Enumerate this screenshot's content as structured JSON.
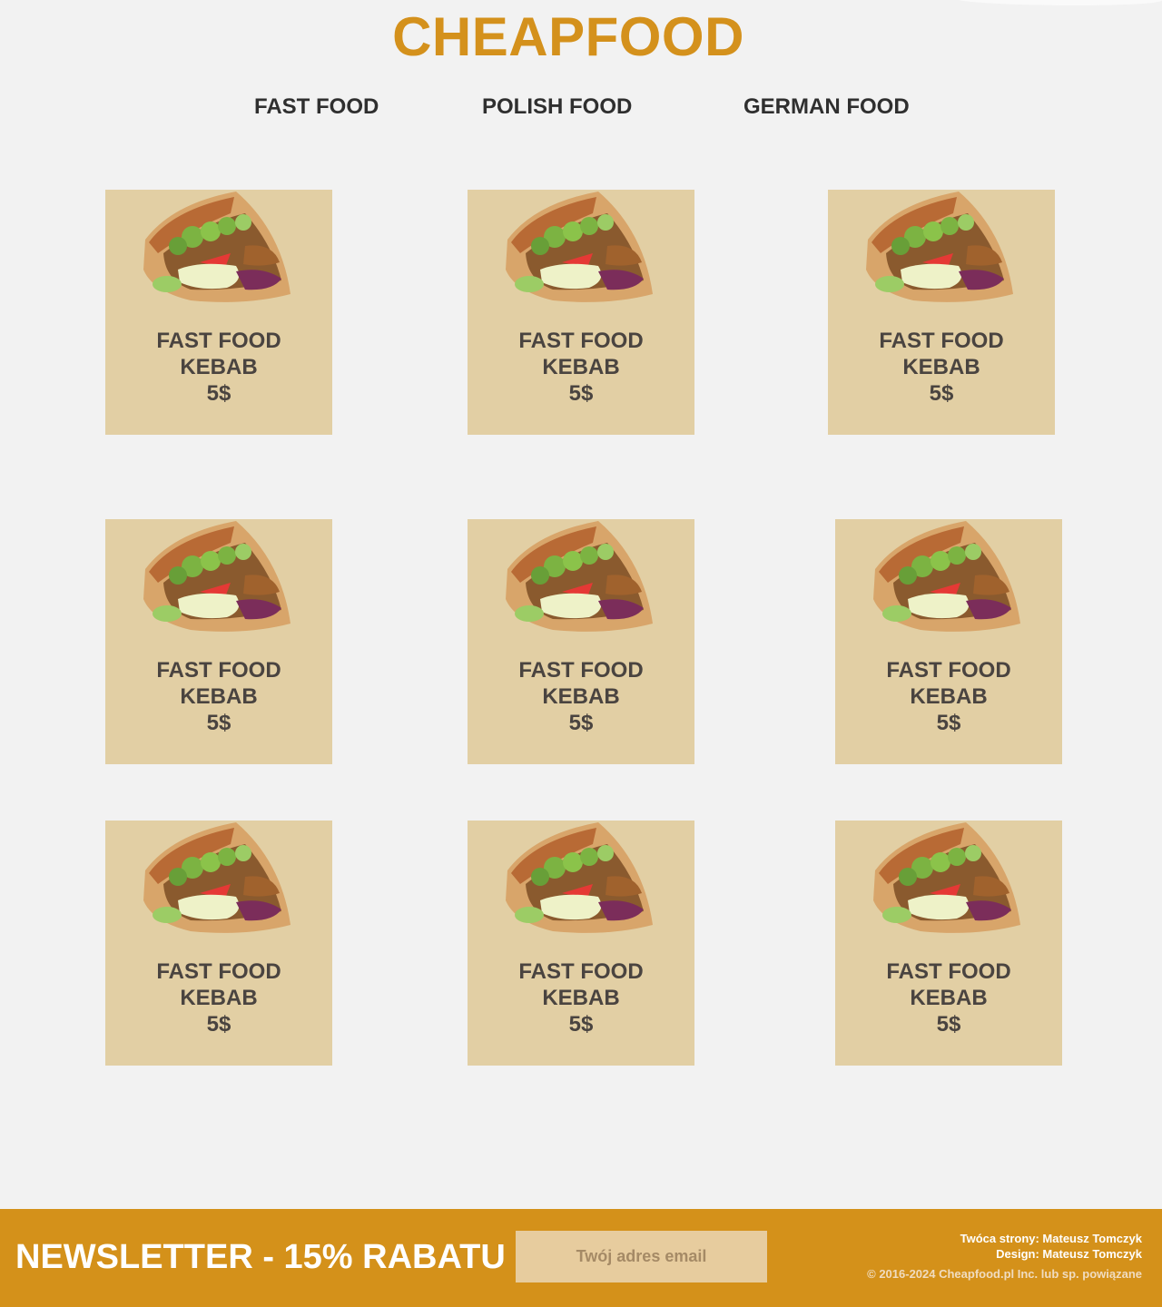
{
  "header": {
    "logo": "CHEAPFOOD"
  },
  "nav": [
    {
      "label": "FAST FOOD"
    },
    {
      "label": "POLISH FOOD"
    },
    {
      "label": "GERMAN FOOD"
    }
  ],
  "products": [
    {
      "category": "FAST FOOD",
      "name": "KEBAB",
      "price": "5$",
      "image": "kebab-image"
    },
    {
      "category": "FAST FOOD",
      "name": "KEBAB",
      "price": "5$",
      "image": "kebab-image"
    },
    {
      "category": "FAST FOOD",
      "name": "KEBAB",
      "price": "5$",
      "image": "kebab-image"
    },
    {
      "category": "FAST FOOD",
      "name": "KEBAB",
      "price": "5$",
      "image": "kebab-image"
    },
    {
      "category": "FAST FOOD",
      "name": "KEBAB",
      "price": "5$",
      "image": "kebab-image"
    },
    {
      "category": "FAST FOOD",
      "name": "KEBAB",
      "price": "5$",
      "image": "kebab-image"
    },
    {
      "category": "FAST FOOD",
      "name": "KEBAB",
      "price": "5$",
      "image": "kebab-image"
    },
    {
      "category": "FAST FOOD",
      "name": "KEBAB",
      "price": "5$",
      "image": "kebab-image"
    },
    {
      "category": "FAST FOOD",
      "name": "KEBAB",
      "price": "5$",
      "image": "kebab-image"
    }
  ],
  "footer": {
    "newsletter_title": "NEWSLETTER - 15% RABATU",
    "email_placeholder": "Twój adres email",
    "creator": "Twóca strony: Mateusz Tomczyk",
    "design": "Design: Mateusz Tomczyk",
    "copyright": "© 2016-2024 Cheapfood.pl Inc. lub sp. powiązane"
  },
  "colors": {
    "brand": "#d4911c",
    "card": "#e2cfa4",
    "footer": "#d4911a",
    "background": "#f2f2f2"
  }
}
